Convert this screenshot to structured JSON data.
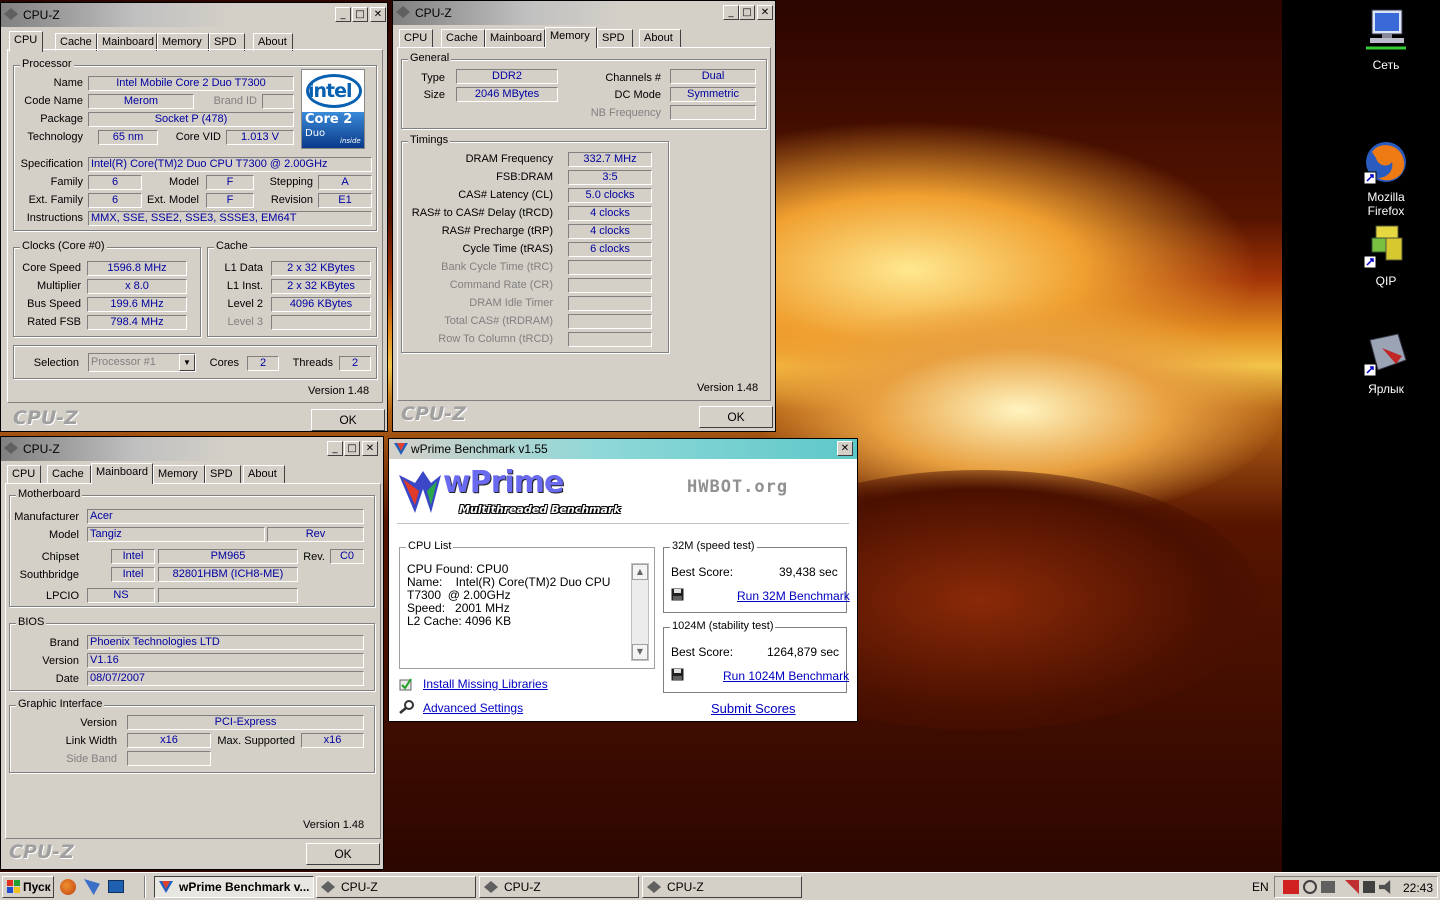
{
  "desktop": {
    "icons": [
      {
        "label": "Сеть",
        "icon": "network-icon"
      },
      {
        "label": "Mozilla\nFirefox",
        "icon": "firefox-icon"
      },
      {
        "label": "QIP",
        "icon": "qip-icon"
      },
      {
        "label": "Ярлык",
        "icon": "shortcut-icon"
      }
    ]
  },
  "cpuz_tabs": [
    "CPU",
    "Cache",
    "Mainboard",
    "Memory",
    "SPD",
    "About"
  ],
  "cpuz_common": {
    "title": "CPU-Z",
    "brand": "CPU-Z",
    "version": "Version 1.48",
    "ok": "OK",
    "minimize": "_",
    "maximize": "□",
    "close": "✕"
  },
  "cpu_win": {
    "processor_title": "Processor",
    "name_label": "Name",
    "name": "Intel Mobile Core 2 Duo T7300",
    "codename_label": "Code Name",
    "codename": "Merom",
    "brandid_label": "Brand ID",
    "brandid": "",
    "package_label": "Package",
    "package": "Socket P (478)",
    "technology_label": "Technology",
    "technology": "65 nm",
    "corevid_label": "Core VID",
    "corevid": "1.013 V",
    "spec_label": "Specification",
    "spec": "Intel(R) Core(TM)2 Duo CPU     T7300  @ 2.00GHz",
    "family_label": "Family",
    "family": "6",
    "model_label": "Model",
    "model": "F",
    "stepping_label": "Stepping",
    "stepping": "A",
    "extfamily_label": "Ext. Family",
    "extfamily": "6",
    "extmodel_label": "Ext. Model",
    "extmodel": "F",
    "revision_label": "Revision",
    "revision": "E1",
    "instructions_label": "Instructions",
    "instructions": "MMX, SSE, SSE2, SSE3, SSSE3, EM64T",
    "clocks_title": "Clocks (Core #0)",
    "corespeed_label": "Core Speed",
    "corespeed": "1596.8 MHz",
    "multiplier_label": "Multiplier",
    "multiplier": "x 8.0",
    "busspeed_label": "Bus Speed",
    "busspeed": "199.6 MHz",
    "ratedfsb_label": "Rated FSB",
    "ratedfsb": "798.4 MHz",
    "cache_title": "Cache",
    "l1data_label": "L1 Data",
    "l1data": "2 x 32 KBytes",
    "l1inst_label": "L1 Inst.",
    "l1inst": "2 x 32 KBytes",
    "level2_label": "Level 2",
    "level2": "4096 KBytes",
    "level3_label": "Level 3",
    "level3": "",
    "selection_label": "Selection",
    "selection": "Processor #1",
    "cores_label": "Cores",
    "cores": "2",
    "threads_label": "Threads",
    "threads": "2",
    "logo_brand": "intel",
    "logo_product": "Core 2",
    "logo_sub": "Duo",
    "logo_inside": "inside"
  },
  "mem_win": {
    "general_title": "General",
    "type_label": "Type",
    "type": "DDR2",
    "size_label": "Size",
    "size": "2046 MBytes",
    "channels_label": "Channels #",
    "channels": "Dual",
    "dcmode_label": "DC Mode",
    "dcmode": "Symmetric",
    "nbfreq_label": "NB Frequency",
    "nbfreq": "",
    "timings_title": "Timings",
    "timings": [
      {
        "label": "DRAM Frequency",
        "value": "332.7 MHz",
        "dim": false
      },
      {
        "label": "FSB:DRAM",
        "value": "3:5",
        "dim": false
      },
      {
        "label": "CAS# Latency (CL)",
        "value": "5.0 clocks",
        "dim": false
      },
      {
        "label": "RAS# to CAS# Delay (tRCD)",
        "value": "4 clocks",
        "dim": false
      },
      {
        "label": "RAS# Precharge (tRP)",
        "value": "4 clocks",
        "dim": false
      },
      {
        "label": "Cycle Time (tRAS)",
        "value": "6 clocks",
        "dim": false
      },
      {
        "label": "Bank Cycle Time (tRC)",
        "value": "",
        "dim": true
      },
      {
        "label": "Command Rate (CR)",
        "value": "",
        "dim": true
      },
      {
        "label": "DRAM Idle Timer",
        "value": "",
        "dim": true
      },
      {
        "label": "Total CAS# (tRDRAM)",
        "value": "",
        "dim": true
      },
      {
        "label": "Row To Column (tRCD)",
        "value": "",
        "dim": true
      }
    ]
  },
  "mb_win": {
    "motherboard_title": "Motherboard",
    "manufacturer_label": "Manufacturer",
    "manufacturer": "Acer",
    "model_label": "Model",
    "model": "Tangiz",
    "rev_label_field": "Rev",
    "chipset_label": "Chipset",
    "chipset_vendor": "Intel",
    "chipset_model": "PM965",
    "rev_label": "Rev.",
    "rev": "C0",
    "southbridge_label": "Southbridge",
    "sb_vendor": "Intel",
    "sb_model": "82801HBM (ICH8-ME)",
    "lpcio_label": "LPCIO",
    "lpcio_vendor": "NS",
    "lpcio_model": "",
    "bios_title": "BIOS",
    "brand_label": "Brand",
    "brand": "Phoenix Technologies LTD",
    "version_label": "Version",
    "version": "V1.16",
    "date_label": "Date",
    "date": "08/07/2007",
    "gi_title": "Graphic Interface",
    "gi_version_label": "Version",
    "gi_version": "PCI-Express",
    "linkwidth_label": "Link Width",
    "linkwidth": "x16",
    "maxsupported_label": "Max. Supported",
    "maxsupported": "x16",
    "sideband_label": "Side Band",
    "sideband": ""
  },
  "wprime": {
    "title": "wPrime Benchmark v1.55",
    "logo": "wPrime",
    "subtitle": "Multithreaded Benchmark",
    "hwbot": "HWBOT.org",
    "cpu_list_title": "CPU List",
    "cpu_list": "CPU Found: CPU0\nName:    Intel(R) Core(TM)2 Duo CPU\nT7300  @ 2.00GHz\nSpeed:   2001 MHz\nL2 Cache: 4096 KB",
    "test32_title": "32M (speed test)",
    "best_score_label": "Best Score:",
    "score32": "39,438 sec",
    "run32": "Run 32M Benchmark",
    "test1024_title": "1024M (stability test)",
    "score1024": "1264,879 sec",
    "run1024": "Run 1024M Benchmark",
    "install_libs": "Install Missing Libraries",
    "advanced": "Advanced Settings",
    "submit": "Submit Scores",
    "close": "✕"
  },
  "taskbar": {
    "start": "Пуск",
    "buttons": [
      "wPrime Benchmark v...",
      "CPU-Z",
      "CPU-Z",
      "CPU-Z"
    ],
    "lang": "EN",
    "clock": "22:43"
  }
}
